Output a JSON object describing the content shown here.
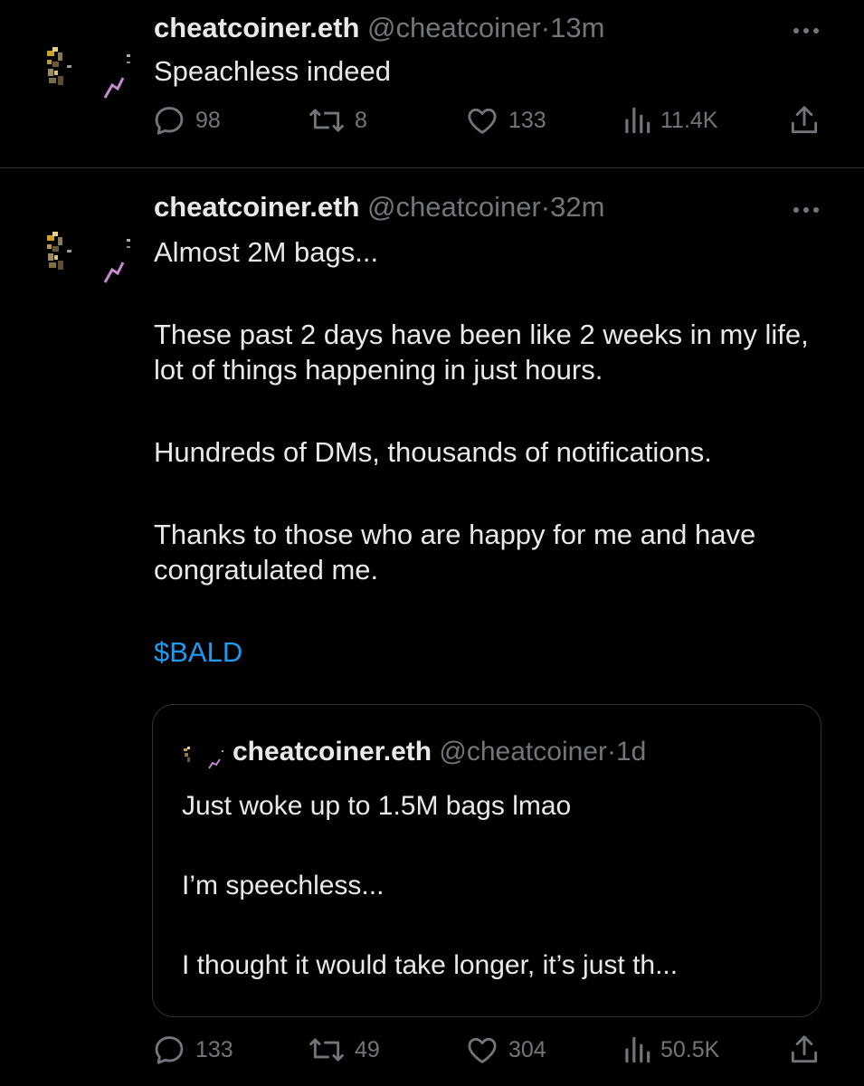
{
  "tweets": [
    {
      "author_name": "cheatcoiner.eth",
      "handle": "@cheatcoiner",
      "separator": "·",
      "time": "13m",
      "text": [
        "Speachless indeed"
      ],
      "stats": {
        "replies": "98",
        "reposts": "8",
        "likes": "133",
        "views": "11.4K"
      }
    },
    {
      "author_name": "cheatcoiner.eth",
      "handle": "@cheatcoiner",
      "separator": "·",
      "time": "32m",
      "text": [
        "Almost 2M bags...",
        "These past 2 days have been like 2 weeks in my life, lot of things happening in just hours.",
        "Hundreds of DMs, thousands of notifications.",
        "Thanks to those who are happy for me and have congratulated me.",
        "$BALD"
      ],
      "quote": {
        "author_name": "cheatcoiner.eth",
        "handle": "@cheatcoiner",
        "separator": "·",
        "time": "1d",
        "text": [
          "Just woke up to 1.5M bags lmao",
          "I’m speechless...",
          "I thought it would take longer, it’s just th..."
        ]
      },
      "stats": {
        "replies": "133",
        "reposts": "49",
        "likes": "304",
        "views": "50.5K"
      }
    }
  ],
  "colors": {
    "background": "#000000",
    "text": "#e7e9ea",
    "secondary": "#71767b",
    "link": "#1d9bf0",
    "border": "#2f3336"
  },
  "icons": {
    "reply": "reply-icon",
    "repost": "repost-icon",
    "like": "heart-icon",
    "views": "views-icon",
    "share": "share-icon",
    "more": "more-icon"
  }
}
